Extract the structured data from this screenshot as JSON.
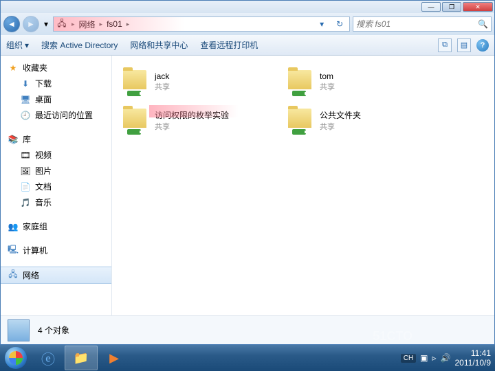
{
  "titlebar": {
    "min": "—",
    "max": "❐",
    "close": "✕"
  },
  "nav": {
    "back_glyph": "◄",
    "fwd_glyph": "►",
    "drop_glyph": "▾",
    "crumb1": "网络",
    "crumb2": "fs01",
    "refresh_glyph": "↻",
    "search_placeholder": "搜索 fs01",
    "search_icon": "🔍"
  },
  "toolbar": {
    "organize": "组织",
    "drop": "▾",
    "search_ad": "搜索 Active Directory",
    "net_center": "网络和共享中心",
    "printers": "查看远程打印机",
    "view_icon": "⧉",
    "preview_icon": "▤",
    "help_icon": "?"
  },
  "sidebar": {
    "favorites": {
      "label": "收藏夹",
      "star": "★",
      "items": [
        {
          "icon": "⬇",
          "label": "下载"
        },
        {
          "icon": "🖥",
          "label": "桌面"
        },
        {
          "icon": "🕘",
          "label": "最近访问的位置"
        }
      ]
    },
    "libraries": {
      "label": "库",
      "icon": "📚",
      "items": [
        {
          "icon": "🎞",
          "label": "视频"
        },
        {
          "icon": "🖼",
          "label": "图片"
        },
        {
          "icon": "📄",
          "label": "文档"
        },
        {
          "icon": "🎵",
          "label": "音乐"
        }
      ]
    },
    "homegroup": {
      "label": "家庭组",
      "icon": "👥"
    },
    "computer": {
      "label": "计算机",
      "icon": "🖳"
    },
    "network": {
      "label": "网络",
      "icon": "🖧"
    }
  },
  "folders": [
    {
      "name": "jack",
      "sub": "共享",
      "highlight": false
    },
    {
      "name": "tom",
      "sub": "共享",
      "highlight": false
    },
    {
      "name": "访问权限的枚举实验",
      "sub": "共享",
      "highlight": true
    },
    {
      "name": "公共文件夹",
      "sub": "共享",
      "highlight": false
    }
  ],
  "status": {
    "count": "4 个对象"
  },
  "tray": {
    "lang": "CH",
    "flag": "▣",
    "net": "▹",
    "vol": "🔊",
    "time": "11:41",
    "date": "2011/10/9"
  },
  "watermark": "51CTO"
}
